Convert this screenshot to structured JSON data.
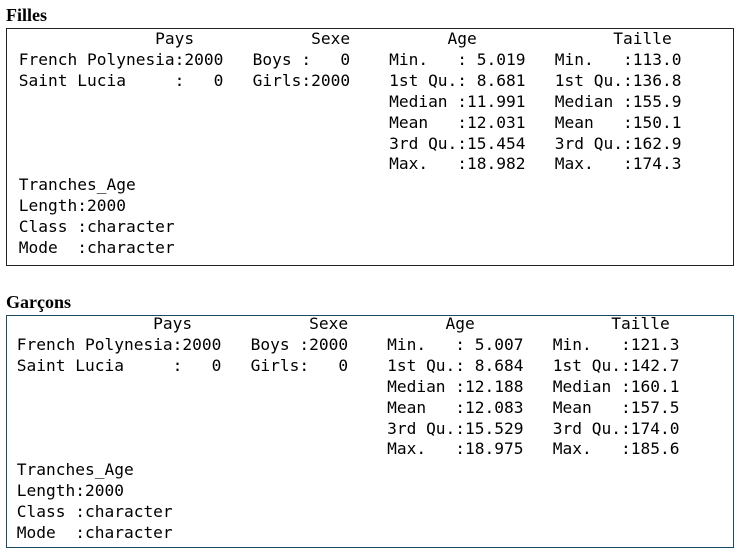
{
  "sections": [
    {
      "title": "Filles",
      "lines": [
        "               Pays            Sexe          Age              Taille      ",
        " French Polynesia:2000   Boys :   0    Min.   : 5.019   Min.   :113.0  ",
        " Saint Lucia     :   0   Girls:2000    1st Qu.: 8.681   1st Qu.:136.8  ",
        "                                       Median :11.991   Median :155.9  ",
        "                                       Mean   :12.031   Mean   :150.1  ",
        "                                       3rd Qu.:15.454   3rd Qu.:162.9  ",
        "                                       Max.   :18.982   Max.   :174.3  ",
        " Tranches_Age      ",
        " Length:2000       ",
        " Class :character  ",
        " Mode  :character  "
      ]
    },
    {
      "title": "Garçons",
      "lines": [
        "               Pays            Sexe          Age              Taille      ",
        " French Polynesia:2000   Boys :2000    Min.   : 5.007   Min.   :121.3  ",
        " Saint Lucia     :   0   Girls:   0    1st Qu.: 8.684   1st Qu.:142.7  ",
        "                                       Median :12.188   Median :160.1  ",
        "                                       Mean   :12.083   Mean   :157.5  ",
        "                                       3rd Qu.:15.529   3rd Qu.:174.0  ",
        "                                       Max.   :18.975   Max.   :185.6  ",
        " Tranches_Age      ",
        " Length:2000       ",
        " Class :character  ",
        " Mode  :character  "
      ]
    }
  ]
}
